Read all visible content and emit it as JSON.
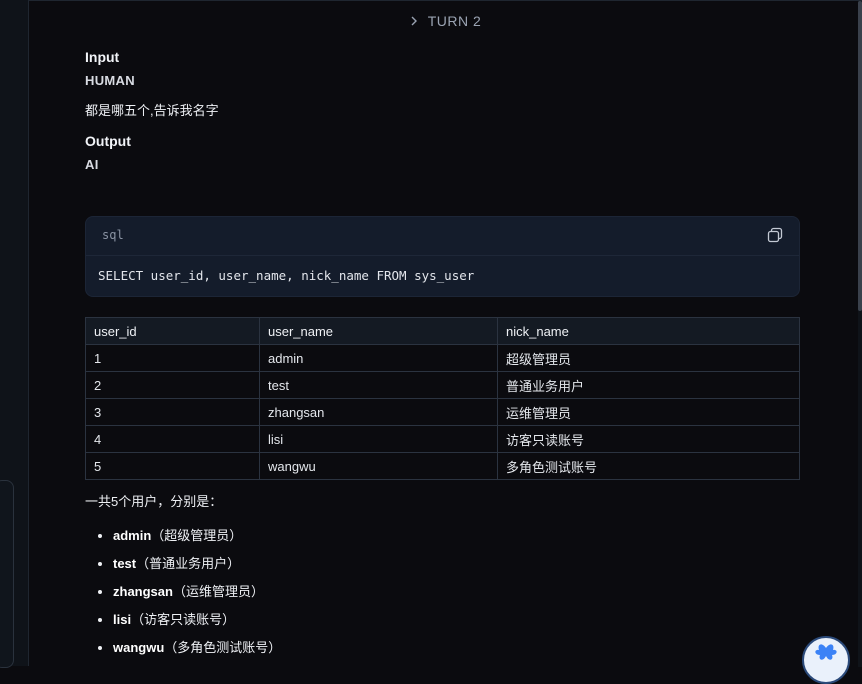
{
  "turn_header": {
    "label": "TURN 2"
  },
  "input": {
    "section_label": "Input",
    "role": "HUMAN",
    "message": "都是哪五个,告诉我名字"
  },
  "output": {
    "section_label": "Output",
    "role": "AI"
  },
  "code": {
    "language": "sql",
    "content": "SELECT user_id, user_name, nick_name FROM sys_user"
  },
  "table": {
    "headers": [
      "user_id",
      "user_name",
      "nick_name"
    ],
    "rows": [
      [
        "1",
        "admin",
        "超级管理员"
      ],
      [
        "2",
        "test",
        "普通业务用户"
      ],
      [
        "3",
        "zhangsan",
        "运维管理员"
      ],
      [
        "4",
        "lisi",
        "访客只读账号"
      ],
      [
        "5",
        "wangwu",
        "多角色测试账号"
      ]
    ]
  },
  "summary": {
    "intro": "一共5个用户，分别是：",
    "items": [
      {
        "name": "admin",
        "desc": "（超级管理员）"
      },
      {
        "name": "test",
        "desc": "（普通业务用户）"
      },
      {
        "name": "zhangsan",
        "desc": "（运维管理员）"
      },
      {
        "name": "lisi",
        "desc": "（访客只读账号）"
      },
      {
        "name": "wangwu",
        "desc": "（多角色测试账号）"
      }
    ]
  },
  "icons": {
    "chevron": "chevron-right-icon",
    "copy": "copy-icon",
    "assistant": "assistant-logo-icon"
  }
}
